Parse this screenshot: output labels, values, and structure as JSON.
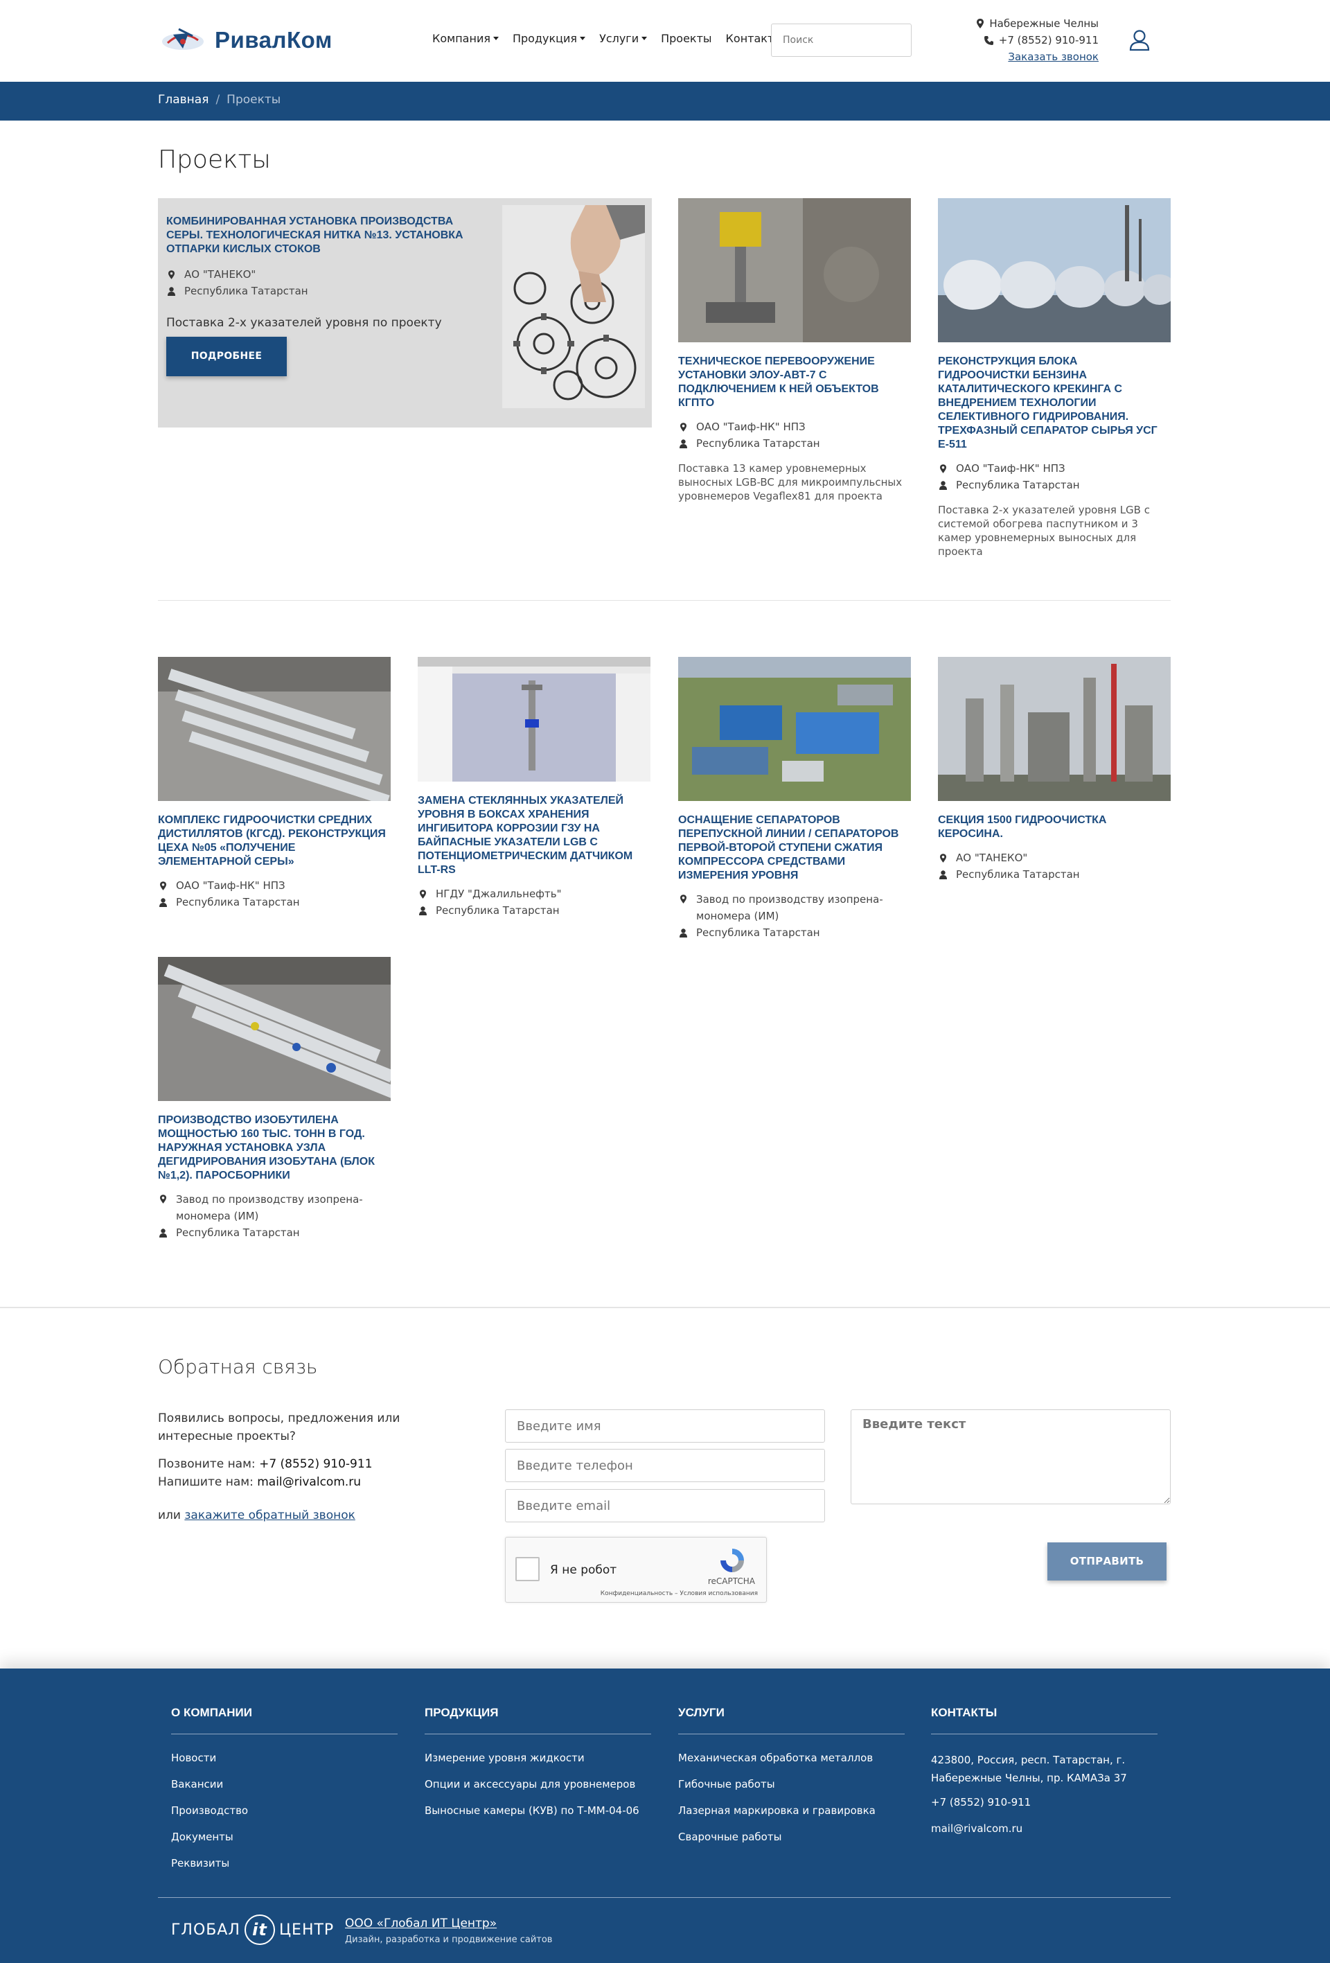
{
  "header": {
    "logo_text": "РивалКом",
    "nav": [
      {
        "label": "Компания",
        "dropdown": true
      },
      {
        "label": "Продукция",
        "dropdown": true
      },
      {
        "label": "Услуги",
        "dropdown": true
      },
      {
        "label": "Проекты",
        "dropdown": false
      },
      {
        "label": "Контакты",
        "dropdown": false
      }
    ],
    "search_placeholder": "Поиск",
    "city": "Набережные Челны",
    "phone": "+7 (8552) 910-911",
    "callback": "Заказать звонок"
  },
  "breadcrumb": {
    "home": "Главная",
    "separator": "/",
    "current": "Проекты"
  },
  "page_title": "Проекты",
  "featured": {
    "title": "КОМБИНИРОВАННАЯ УСТАНОВКА ПРОИЗВОДСТВА СЕРЫ. ТЕХНОЛОГИЧЕСКАЯ НИТКА №13. УСТАНОВКА ОТПАРКИ КИСЛЫХ СТОКОВ",
    "company": "АО \"ТАНЕКО\"",
    "region": "Республика Татарстан",
    "description": "Поставка 2-х указателей уровня по проекту",
    "button": "ПОДРОБНЕЕ"
  },
  "projects": [
    {
      "title": "ТЕХНИЧЕСКОЕ ПЕРЕВООРУЖЕНИЕ УСТАНОВКИ ЭЛОУ-АВТ-7 С ПОДКЛЮЧЕНИЕМ К НЕЙ ОБЪЕКТОВ КГПТО",
      "company": "ОАО \"Таиф-НК\" НПЗ",
      "region": "Республика Татарстан",
      "description": "Поставка 13 камер уровнемерных выносных LGB-BC для микроимпульсных уровнемеров Vegaflex81 для проекта"
    },
    {
      "title": "РЕКОНСТРУКЦИЯ БЛОКА ГИДРООЧИСТКИ БЕНЗИНА КАТАЛИТИЧЕСКОГО КРЕКИНГА С ВНЕДРЕНИЕМ ТЕХНОЛОГИИ СЕЛЕКТИВНОГО ГИДРИРОВАНИЯ. ТРЕХФАЗНЫЙ СЕПАРАТОР СЫРЬЯ УСГ Е-511",
      "company": "ОАО \"Таиф-НК\" НПЗ",
      "region": "Республика Татарстан",
      "description": "Поставка 2-х указателей уровня LGB с системой обогрева паспутником и 3 камер уровнемерных выносных для проекта"
    },
    {
      "title": "КОМПЛЕКС ГИДРООЧИСТКИ СРЕДНИХ ДИСТИЛЛЯТОВ (КГСД). РЕКОНСТРУКЦИЯ ЦЕХА №05 «ПОЛУЧЕНИЕ ЭЛЕМЕНТАРНОЙ СЕРЫ»",
      "company": "ОАО \"Таиф-НК\" НПЗ",
      "region": "Республика Татарстан",
      "description": ""
    },
    {
      "title": "ЗАМЕНА СТЕКЛЯННЫХ УКАЗАТЕЛЕЙ УРОВНЯ В БОКСАХ ХРАНЕНИЯ ИНГИБИТОРА КОРРОЗИИ ГЗУ НА БАЙПАСНЫЕ УКАЗАТЕЛИ LGB С ПОТЕНЦИОМЕТРИЧЕСКИМ ДАТЧИКОМ LLT-RS",
      "company": "НГДУ \"Джалильнефть\"",
      "region": "Республика Татарстан",
      "description": ""
    },
    {
      "title": "ОСНАЩЕНИЕ СЕПАРАТОРОВ ПЕРЕПУСКНОЙ ЛИНИИ / СЕПАРАТОРОВ ПЕРВОЙ-ВТОРОЙ СТУПЕНИ СЖАТИЯ КОМПРЕССОРА СРЕДСТВАМИ ИЗМЕРЕНИЯ УРОВНЯ",
      "company": "Завод по производству изопрена-мономера (ИМ)",
      "region": "Республика Татарстан",
      "description": ""
    },
    {
      "title": "СЕКЦИЯ 1500 ГИДРООЧИСТКА КЕРОСИНА.",
      "company": "АО \"ТАНЕКО\"",
      "region": "Республика Татарстан",
      "description": ""
    },
    {
      "title": "ПРОИЗВОДСТВО ИЗОБУТИЛЕНА МОЩНОСТЬЮ 160 ТЫС. ТОНН В ГОД. НАРУЖНАЯ УСТАНОВКА УЗЛА ДЕГИДРИРОВАНИЯ ИЗОБУТАНА (БЛОК №1,2). ПАРОСБОРНИКИ",
      "company": "Завод по производству изопрена-мономера (ИМ)",
      "region": "Республика Татарстан",
      "description": ""
    }
  ],
  "feedback": {
    "title": "Обратная связь",
    "intro": "Появились вопросы, предложения или интересные проекты?",
    "call_label": "Позвоните нам:",
    "call_value": "+7 (8552) 910-911",
    "write_label": "Напишите нам:",
    "write_value": "mail@rivalcom.ru",
    "or_label": "или",
    "callback_link": "закажите обратный звонок",
    "name_placeholder": "Введите имя",
    "phone_placeholder": "Введите телефон",
    "email_placeholder": "Введите email",
    "text_placeholder": "Введите текст",
    "captcha_label": "Я не робот",
    "captcha_brand": "reCAPTCHA",
    "captcha_terms": "Конфиденциальность – Условия использования",
    "submit": "ОТПРАВИТЬ"
  },
  "footer": {
    "company": {
      "title": "О КОМПАНИИ",
      "links": [
        "Новости",
        "Вакансии",
        "Производство",
        "Документы",
        "Реквизиты"
      ]
    },
    "products": {
      "title": "ПРОДУКЦИЯ",
      "links": [
        "Измерение уровня жидкости",
        "Опции и аксессуары для уровнемеров",
        "Выносные камеры (КУВ) по Т-ММ-04-06"
      ]
    },
    "services": {
      "title": "УСЛУГИ",
      "links": [
        "Механическая обработка металлов",
        "Гибочные работы",
        "Лазерная маркировка и гравировка",
        "Сварочные работы"
      ]
    },
    "contacts": {
      "title": "КОНТАКТЫ",
      "address": "423800, Россия, респ. Татарстан, г. Набережные Челны, пр. КАМАЗа 37",
      "phone": "+7 (8552) 910-911",
      "email": "mail@rivalcom.ru"
    },
    "dev_logo_left": "ГЛОБАЛ",
    "dev_logo_mid": "it",
    "dev_logo_right": "ЦЕНТР",
    "dev_org": "ООО «Глобал ИТ Центр»",
    "dev_sub": "Дизайн, разработка и продвижение сайтов"
  },
  "colors": {
    "brand_blue": "#1a4b7d",
    "link_blue": "#1d4b7e",
    "submit_disabled": "#6b8cb0",
    "featured_bg": "#dcdcdc"
  }
}
